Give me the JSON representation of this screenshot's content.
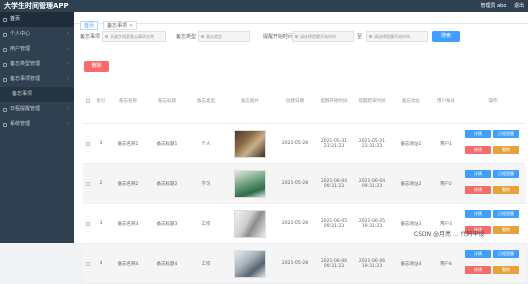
{
  "header": {
    "app_title": "大学生时间管理APP",
    "user_role": "管理员 abo",
    "logout": "退出"
  },
  "sidebar": {
    "items": [
      {
        "label": "首页",
        "active": true,
        "arrow": false,
        "sub": false
      },
      {
        "label": "个人中心",
        "active": false,
        "arrow": true,
        "sub": false
      },
      {
        "label": "用户管理",
        "active": false,
        "arrow": true,
        "sub": false
      },
      {
        "label": "备忘类型管理",
        "active": false,
        "arrow": true,
        "sub": false
      },
      {
        "label": "备忘事项管理",
        "active": false,
        "arrow": true,
        "sub": false
      },
      {
        "label": "备忘事项",
        "active": false,
        "arrow": false,
        "sub": true
      },
      {
        "label": "日程提醒管理",
        "active": false,
        "arrow": true,
        "sub": false
      },
      {
        "label": "系统管理",
        "active": false,
        "arrow": true,
        "sub": false
      }
    ]
  },
  "tabs": [
    {
      "label": "首页",
      "active": true
    },
    {
      "label": "备忘事项",
      "active": false
    }
  ],
  "search": {
    "title_label": "备忘事项",
    "title_value": "关键字搜索备忘事项名称",
    "category_label": "备忘类型",
    "category_placeholder": "备忘类型",
    "time_label": "提醒开始时间",
    "time_start_placeholder": "请选择提醒开始时间",
    "time_tilde": "至",
    "time_end_placeholder": "请选择提醒开始时间",
    "button": "搜索"
  },
  "delete_button": "删除",
  "table": {
    "headers": [
      "索引",
      "备忘名称",
      "备忘标题",
      "备忘类型",
      "备忘图片",
      "创建日期",
      "提醒开始时间",
      "提醒结束时间",
      "备忘地址",
      "用户账号",
      "操作"
    ],
    "rows": [
      {
        "index": "1",
        "name": "备忘名称1",
        "title": "备忘标题1",
        "type": "个人",
        "photo": "p1",
        "date": "2021-05-28",
        "start": "2021-05-31\n23:31:23",
        "end": "2021-05-31\n23:31:23",
        "address": "备忘地址1",
        "account": "用户1"
      },
      {
        "index": "2",
        "name": "备忘名称2",
        "title": "备忘标题2",
        "type": "学习",
        "photo": "p2",
        "date": "2021-05-28",
        "start": "2021-06-04\n09:31:23",
        "end": "2021-06-04\n09:31:23",
        "address": "备忘地址2",
        "account": "用户2"
      },
      {
        "index": "3",
        "name": "备忘名称3",
        "title": "备忘标题3",
        "type": "工作",
        "photo": "p3",
        "date": "2021-05-28",
        "start": "2021-06-05\n09:31:23",
        "end": "2021-06-05\n19:31:23",
        "address": "备忘地址3",
        "account": "用户3"
      },
      {
        "index": "4",
        "name": "备忘名称4",
        "title": "备忘标题4",
        "type": "工作",
        "photo": "p4",
        "date": "2021-05-28",
        "start": "2021-06-06\n09:31:23",
        "end": "2021-06-06\n19:31:23",
        "address": "备忘地址4",
        "account": "用户4"
      }
    ],
    "actions": {
      "detail": "详情",
      "remind": "日程提醒",
      "edit": "修改",
      "delete": "删除"
    }
  },
  "watermark": "CSDN @月亮 ... 代码毕设",
  "colors": {
    "sidebar": "#2f4050",
    "primary": "#409eff",
    "danger": "#f56c6c",
    "warning": "#e6a23c"
  }
}
